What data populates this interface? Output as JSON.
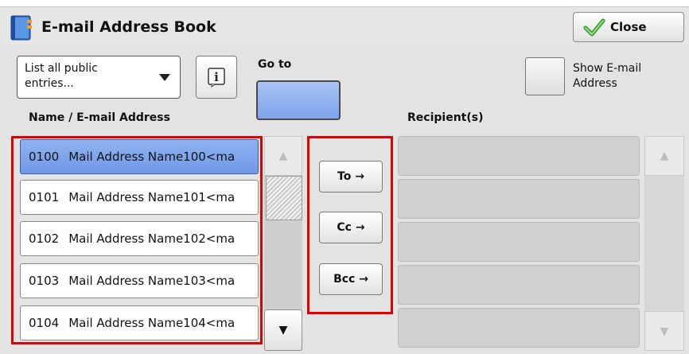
{
  "window": {
    "title": "E-mail Address Book",
    "close_label": "Close",
    "title_icon": "address-book-icon",
    "close_icon": "green-checkmark-icon"
  },
  "filter": {
    "selected": "List all public entries...",
    "info_icon": "info-icon"
  },
  "goto": {
    "label": "Go to",
    "value": ""
  },
  "show_email": {
    "label": "Show E-mail Address",
    "checked": false
  },
  "columns": {
    "left": "Name / E-mail Address",
    "right": "Recipient(s)"
  },
  "entries": [
    {
      "num": "0100",
      "name": "Mail Address Name100<ma",
      "selected": true
    },
    {
      "num": "0101",
      "name": "Mail Address Name101<ma",
      "selected": false
    },
    {
      "num": "0102",
      "name": "Mail Address Name102<ma",
      "selected": false
    },
    {
      "num": "0103",
      "name": "Mail Address Name103<ma",
      "selected": false
    },
    {
      "num": "0104",
      "name": "Mail Address Name104<ma",
      "selected": false
    }
  ],
  "actions": {
    "to": "To →",
    "cc": "Cc →",
    "bcc": "Bcc →"
  },
  "recipients": [],
  "scroll": {
    "up": "▲",
    "down": "▼"
  },
  "colors": {
    "selected": "#7ea3ea",
    "highlight": "#e00000",
    "panel": "#e3e3e3"
  }
}
